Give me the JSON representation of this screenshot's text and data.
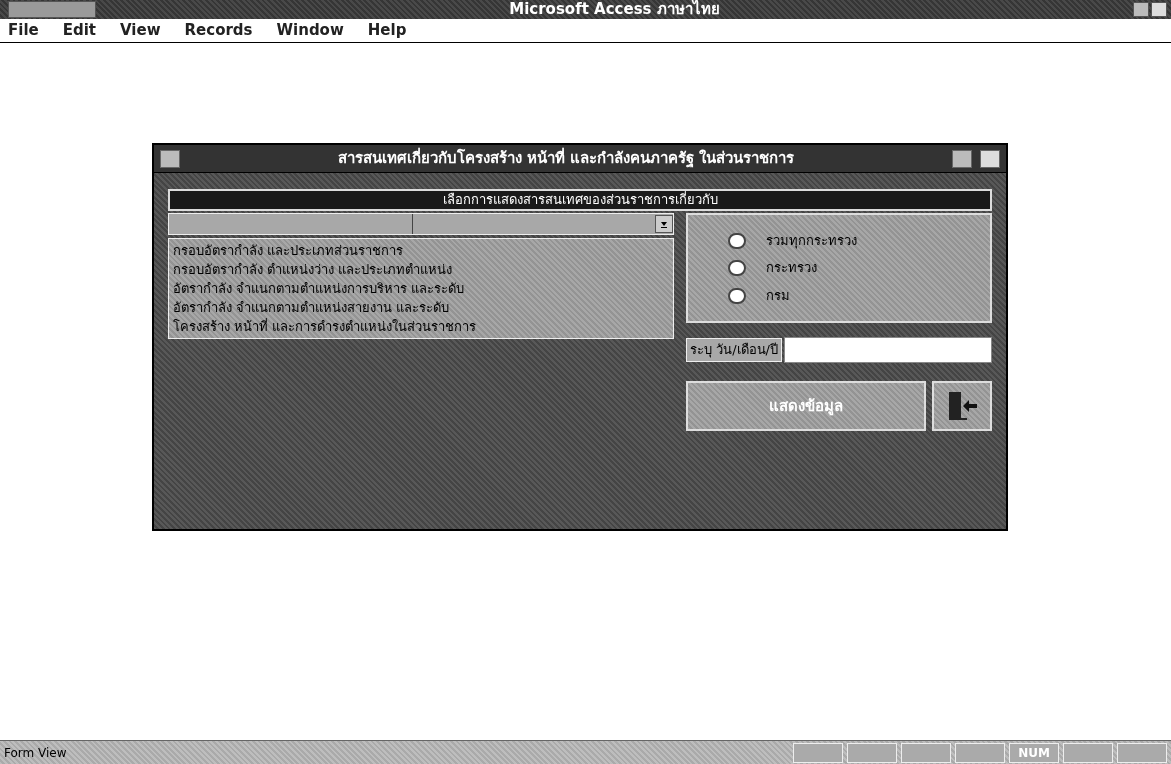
{
  "app_title": "Microsoft Access ภาษาไทย",
  "menu": [
    "File",
    "Edit",
    "View",
    "Records",
    "Window",
    "Help"
  ],
  "form": {
    "title": "สารสนเทศเกี่ยวกับโครงสร้าง หน้าที่ และกำลังคนภาครัฐ ในส่วนราชการ",
    "header": "เลือกการแสดงสารสนเทศของส่วนราชการเกี่ยวกับ",
    "list_items": [
      {
        "label": "กรอบอัตรากำลัง และประเภทส่วนราชการ",
        "selected": false
      },
      {
        "label": "กรอบอัตรากำลัง ตำแหน่งว่าง และประเภทตำแหน่ง",
        "selected": false
      },
      {
        "label": "อัตรากำลัง จำแนกตามตำแหน่งการบริหาร และระดับ",
        "selected": false
      },
      {
        "label": "อัตรากำลัง จำแนกตามตำแหน่งสายงาน และระดับ",
        "selected": false
      },
      {
        "label": "โครงสร้าง หน้าที่ และการดำรงตำแหน่งในส่วนราชการ",
        "selected": false
      }
    ],
    "radios": [
      {
        "label": "รวมทุกกระทรวง",
        "selected": false
      },
      {
        "label": "กระทรวง",
        "selected": false
      },
      {
        "label": "กรม",
        "selected": false
      }
    ],
    "date_label": "ระบุ วัน/เดือน/ปี",
    "show_button": "แสดงข้อมูล"
  },
  "status_bar": {
    "mode": "Form View",
    "num_indicator": "NUM"
  }
}
